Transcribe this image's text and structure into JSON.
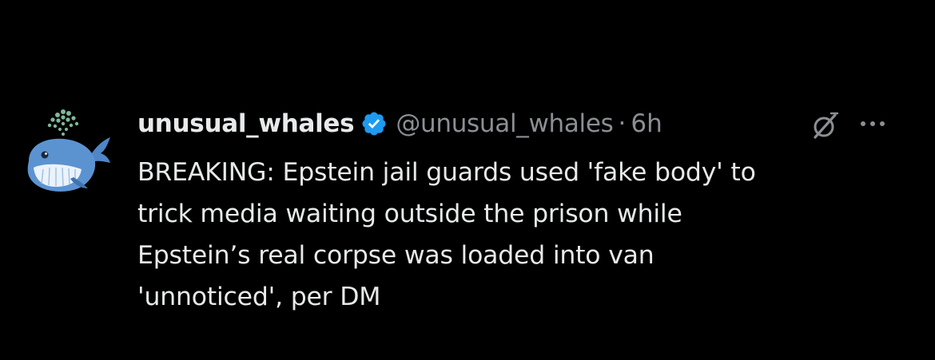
{
  "tweet": {
    "display_name": "unusual_whales",
    "handle": "@unusual_whales",
    "separator": "·",
    "time": "6h",
    "text": "BREAKING: Epstein jail guards used 'fake body' to\ntrick media waiting outside the prison while\nEpstein’s real corpse was loaded into van\n'unnoticed', per DM"
  },
  "icons": {
    "avatar": "whale-avatar-icon",
    "verified": "verified-badge-icon",
    "grok": "grok-icon",
    "more": "more-options-icon"
  },
  "colors": {
    "background": "#000000",
    "text": "#e7e9ea",
    "secondary_text": "#8b8f94",
    "verified_blue": "#1d9bf0"
  }
}
